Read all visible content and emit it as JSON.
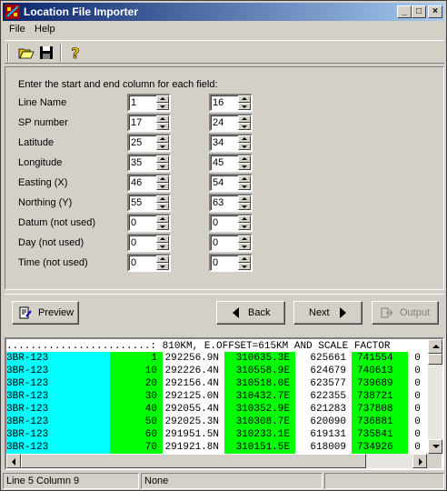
{
  "window": {
    "title": "Location File Importer"
  },
  "menu": {
    "file": "File",
    "help": "Help"
  },
  "toolbar": {
    "open_icon": "folder-open-icon",
    "save_icon": "floppy-disk-icon",
    "help_icon": "question-mark-icon"
  },
  "form": {
    "instruction": "Enter the start and end column for each field:",
    "fields": [
      {
        "label": "Line Name",
        "start": "1",
        "end": "16"
      },
      {
        "label": "SP number",
        "start": "17",
        "end": "24"
      },
      {
        "label": "Latitude",
        "start": "25",
        "end": "34"
      },
      {
        "label": "Longitude",
        "start": "35",
        "end": "45"
      },
      {
        "label": "Easting (X)",
        "start": "46",
        "end": "54"
      },
      {
        "label": "Northing (Y)",
        "start": "55",
        "end": "63"
      },
      {
        "label": "Datum (not used)",
        "start": "0",
        "end": "0"
      },
      {
        "label": "Day (not used)",
        "start": "0",
        "end": "0"
      },
      {
        "label": "Time (not used)",
        "start": "0",
        "end": "0"
      }
    ]
  },
  "buttons": {
    "preview": "Preview",
    "back": "Back",
    "next": "Next",
    "output": "Output"
  },
  "preview": {
    "header": "........................: 810KM, E.OFFSET=615KM AND SCALE FACTOR",
    "rows": [
      {
        "line": "3BR-123",
        "sp": "1",
        "lat": "292256.9N",
        "lon": "310635.3E",
        "east": "625661",
        "north": "741554",
        "rest": "0"
      },
      {
        "line": "3BR-123",
        "sp": "10",
        "lat": "292226.4N",
        "lon": "310558.9E",
        "east": "624679",
        "north": "740613",
        "rest": "0"
      },
      {
        "line": "3BR-123",
        "sp": "20",
        "lat": "292156.4N",
        "lon": "310518.0E",
        "east": "623577",
        "north": "739689",
        "rest": "0"
      },
      {
        "line": "3BR-123",
        "sp": "30",
        "lat": "292125.0N",
        "lon": "310432.7E",
        "east": "622355",
        "north": "738721",
        "rest": "0"
      },
      {
        "line": "3BR-123",
        "sp": "40",
        "lat": "292055.4N",
        "lon": "310352.9E",
        "east": "621283",
        "north": "737808",
        "rest": "0"
      },
      {
        "line": "3BR-123",
        "sp": "50",
        "lat": "292025.3N",
        "lon": "310308.7E",
        "east": "620090",
        "north": "736881",
        "rest": "0"
      },
      {
        "line": "3BR-123",
        "sp": "60",
        "lat": "291951.5N",
        "lon": "310233.1E",
        "east": "619131",
        "north": "735841",
        "rest": "0"
      },
      {
        "line": "3BR-123",
        "sp": "70",
        "lat": "291921.8N",
        "lon": "310151.5E",
        "east": "618009",
        "north": "734926",
        "rest": "0"
      }
    ]
  },
  "status": {
    "position": "Line 5 Column 9",
    "info": "None"
  },
  "colors": {
    "cyan": "#00ffff",
    "green": "#00ff00",
    "title_start": "#0a246a",
    "title_end": "#a6caf0"
  }
}
